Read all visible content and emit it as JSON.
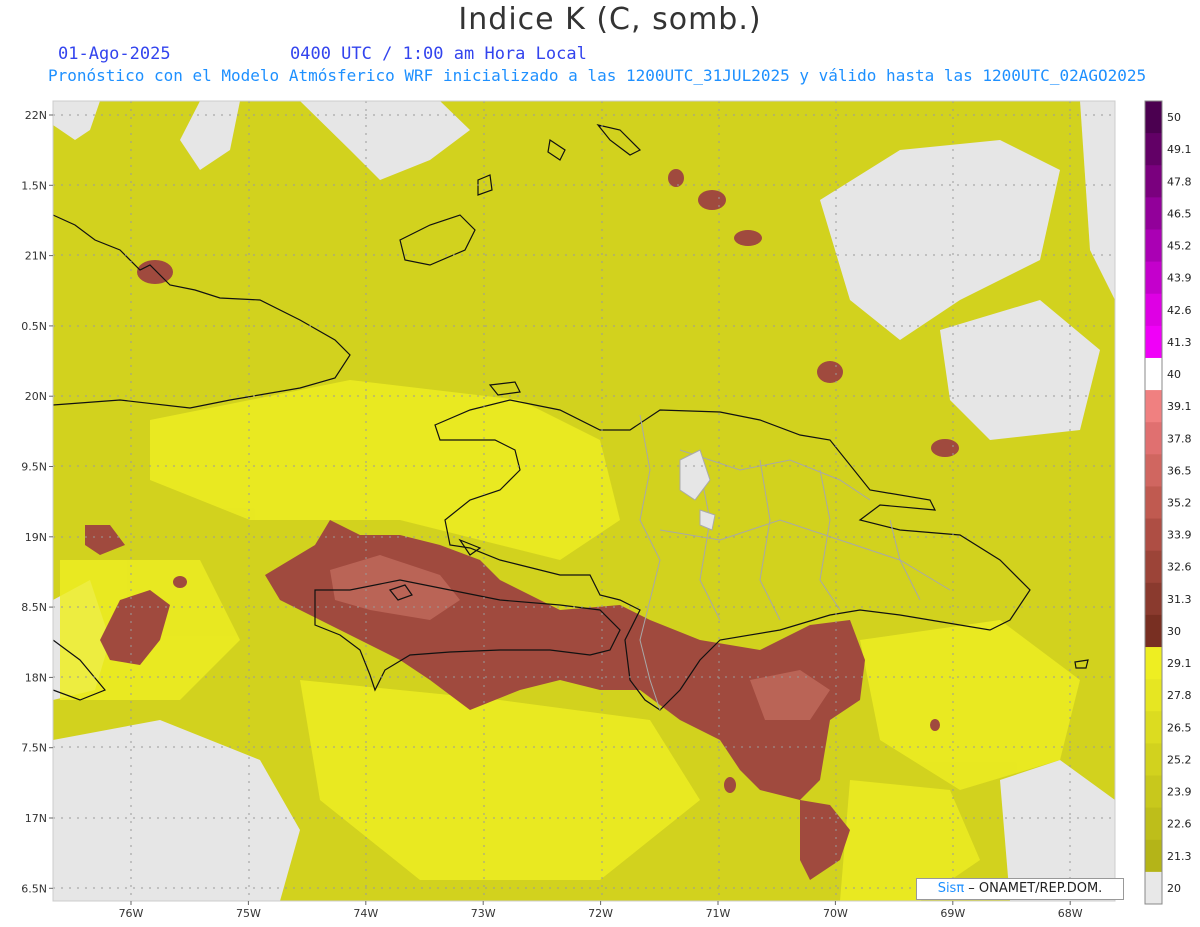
{
  "header": {
    "title": "Indice K (C, somb.)",
    "date": "01-Ago-2025",
    "time": "0400 UTC / 1:00 am Hora Local",
    "model_line": "Pronóstico con el Modelo Atmósferico WRF inicializado a las 1200UTC_31JUL2025 y válido hasta las  1200UTC_02AGO2025"
  },
  "credit": {
    "brand": "Sisπ",
    "text": " – ONAMET/REP.DOM."
  },
  "axes": {
    "lat_labels": [
      "22N",
      "1.5N",
      "21N",
      "0.5N",
      "20N",
      "9.5N",
      "19N",
      "8.5N",
      "18N",
      "7.5N",
      "17N",
      "6.5N"
    ],
    "lon_labels": [
      "76W",
      "75W",
      "74W",
      "73W",
      "72W",
      "71W",
      "70W",
      "69W",
      "68W"
    ]
  },
  "colorbar": {
    "labels": [
      "50",
      "49.1",
      "47.8",
      "46.5",
      "45.2",
      "43.9",
      "42.6",
      "41.3",
      "40",
      "39.1",
      "37.8",
      "36.5",
      "35.2",
      "33.9",
      "32.6",
      "31.3",
      "30",
      "29.1",
      "27.8",
      "26.5",
      "25.2",
      "23.9",
      "22.6",
      "21.3",
      "20"
    ],
    "colors": [
      "#4b0050",
      "#620066",
      "#7a007e",
      "#92009a",
      "#aa00b4",
      "#c400cc",
      "#de00e4",
      "#f000f8",
      "#ffffff",
      "#f08080",
      "#e07070",
      "#d06660",
      "#c05a50",
      "#ae4e44",
      "#9c4438",
      "#8a3a2e",
      "#782f22",
      "#eeee22",
      "#e6e622",
      "#dcdc20",
      "#d2d21e",
      "#c8c81c",
      "#bebe1a",
      "#b4b418",
      "#e8e8e8"
    ]
  },
  "colors": {
    "ocean_low": "#e6e6e6",
    "field_mid": "#d2d21e",
    "field_high": "#f0f020",
    "hot": "#a04a3e"
  }
}
